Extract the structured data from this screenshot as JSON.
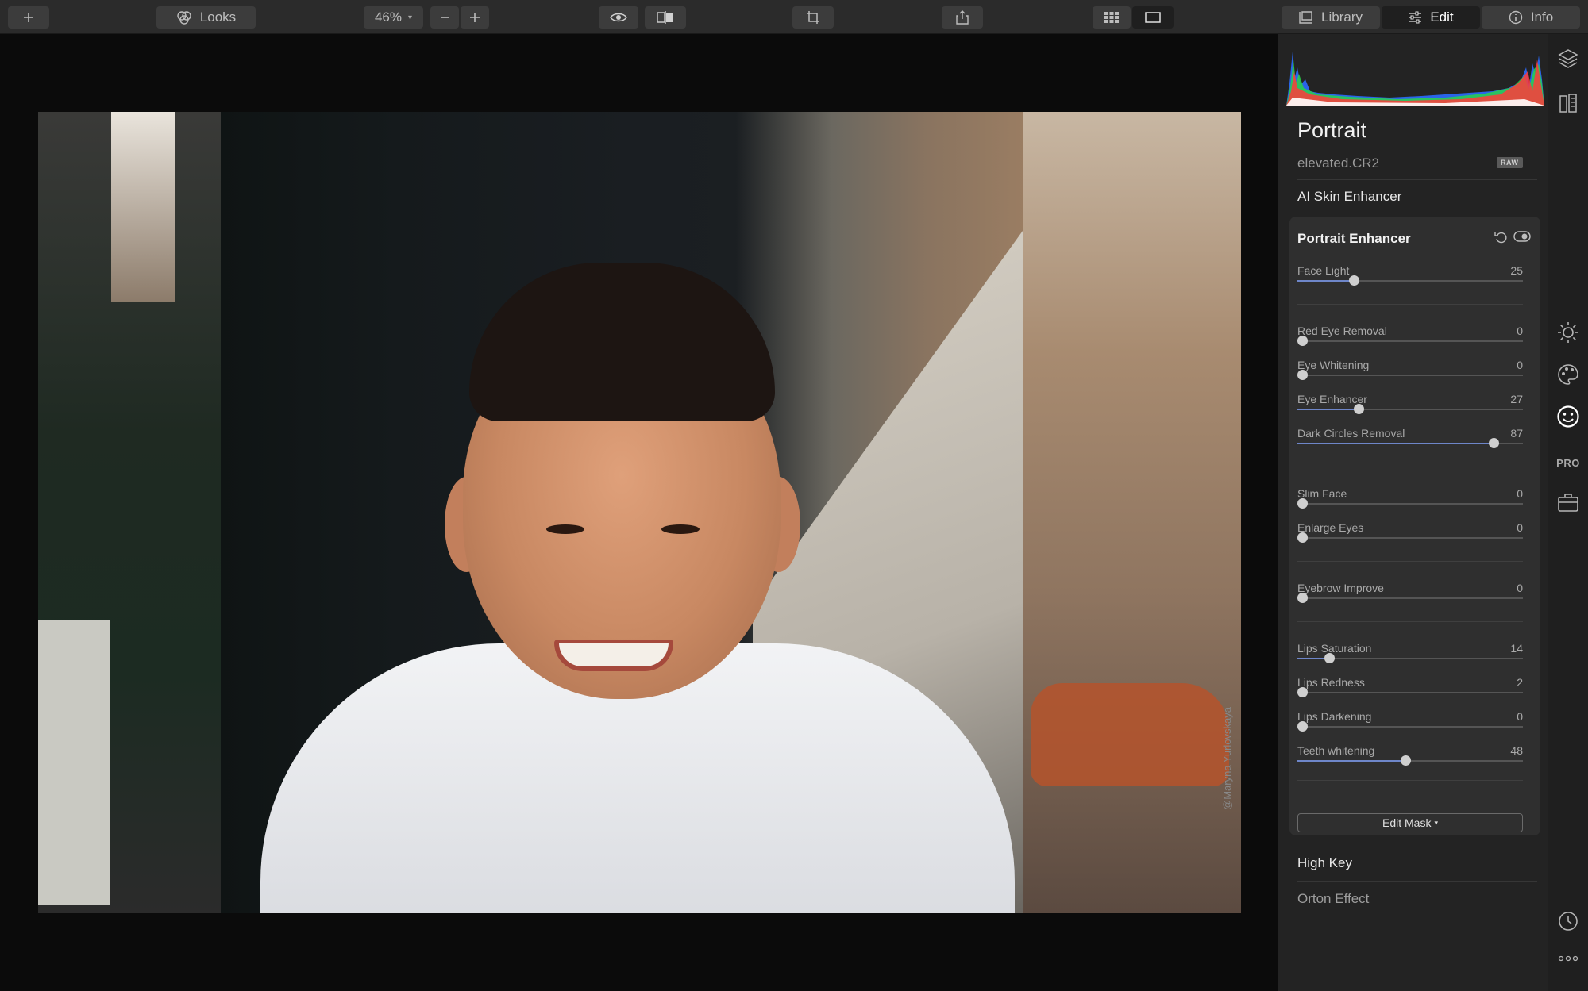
{
  "toolbar": {
    "add_label": "+",
    "looks_label": "Looks",
    "zoom_value": "46%",
    "zoom_out_label": "−",
    "zoom_in_label": "+",
    "library_label": "Library",
    "edit_label": "Edit",
    "info_label": "Info"
  },
  "photo": {
    "credit": "@Maryna Yurlovskaya"
  },
  "panel": {
    "title": "Portrait",
    "filename": "elevated.CR2",
    "badge": "RAW",
    "ai_skin_label": "AI Skin Enhancer",
    "card_title": "Portrait Enhancer",
    "sliders": [
      {
        "label": "Face Light",
        "value": "25",
        "max": 100
      },
      {
        "label": "Red Eye Removal",
        "value": "0",
        "max": 100
      },
      {
        "label": "Eye Whitening",
        "value": "0",
        "max": 100
      },
      {
        "label": "Eye Enhancer",
        "value": "27",
        "max": 100
      },
      {
        "label": "Dark Circles Removal",
        "value": "87",
        "max": 100
      },
      {
        "label": "Slim Face",
        "value": "0",
        "max": 100
      },
      {
        "label": "Enlarge Eyes",
        "value": "0",
        "max": 100
      },
      {
        "label": "Eyebrow Improve",
        "value": "0",
        "max": 100
      },
      {
        "label": "Lips Saturation",
        "value": "14",
        "max": 100
      },
      {
        "label": "Lips Redness",
        "value": "2",
        "max": 100
      },
      {
        "label": "Lips Darkening",
        "value": "0",
        "max": 100
      },
      {
        "label": "Teeth whitening",
        "value": "48",
        "max": 100
      }
    ],
    "edit_mask_label": "Edit Mask",
    "high_key_label": "High Key",
    "orton_label": "Orton Effect"
  },
  "rail": {
    "pro_label": "PRO"
  },
  "colors": {
    "accent": "#6e86c9",
    "panel_bg": "#232323",
    "card_bg": "#2f2f2f"
  }
}
